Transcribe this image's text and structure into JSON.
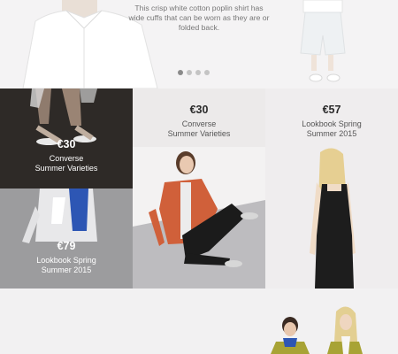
{
  "hero": {
    "caption": "This crisp white cotton poplin shirt has wide cuffs that can be worn as they are or folded back.",
    "pagination": {
      "count": 4,
      "active_index": 0
    }
  },
  "tiles": [
    {
      "price": "€30",
      "name_line1": "Converse",
      "name_line2": "Summer Varieties"
    },
    {
      "price": "€79",
      "name_line1": "Lookbook Spring",
      "name_line2": "Summer 2015"
    },
    {
      "price": "€30",
      "name_line1": "Converse",
      "name_line2": "Summer Varieties"
    },
    {
      "price": "€57",
      "name_line1": "Lookbook Spring",
      "name_line2": "Summer 2015"
    }
  ],
  "colors": {
    "accent_orange": "#d0603a",
    "dress_black": "#1d1d1d",
    "jacket_olive": "#a8a335",
    "jacket_blue": "#2d56b4"
  }
}
